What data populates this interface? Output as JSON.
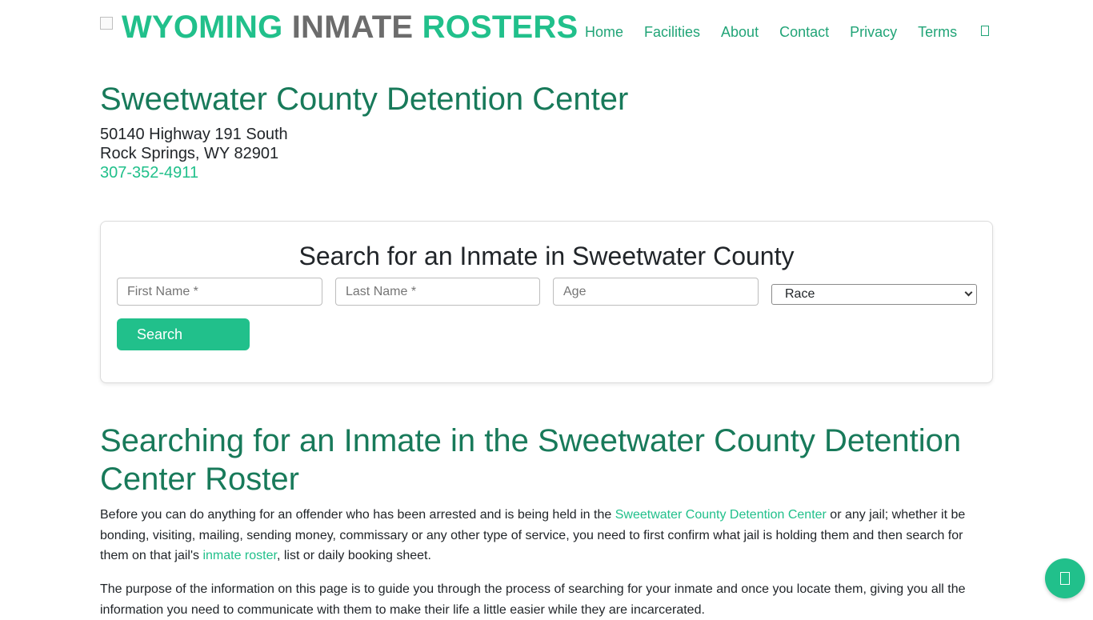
{
  "header": {
    "logo_part1": "WYOMING",
    "logo_part2": "INMATE",
    "logo_part3": "ROSTERS",
    "nav": [
      "Home",
      "Facilities",
      "About",
      "Contact",
      "Privacy",
      "Terms"
    ],
    "nav_extra_icon": "box-icon"
  },
  "facility": {
    "name": "Sweetwater County Detention Center",
    "address_line1": "50140 Highway 191 South",
    "address_line2": "Rock Springs, WY 82901",
    "phone": "307-352-4911"
  },
  "search": {
    "title": "Search for an Inmate in Sweetwater County",
    "first_name_placeholder": "First Name *",
    "last_name_placeholder": "Last Name *",
    "age_placeholder": "Age",
    "race_selected": "Race",
    "button_label": "Search"
  },
  "article": {
    "heading": "Searching for an Inmate in the Sweetwater County Detention Center Roster",
    "p1_a": "Before you can do anything for an offender who has been arrested and is being held in the ",
    "p1_link1": "Sweetwater County Detention Center",
    "p1_b": " or any jail; whether it be bonding, visiting, mailing, sending money, commissary or any other type of service, you need to first confirm what jail is holding them and then search for them on that jail's ",
    "p1_link2": "inmate roster",
    "p1_c": ", list or daily booking sheet.",
    "p2": "The purpose of the information on this page is to guide you through the process of searching for your inmate and once you locate them, giving you all the information you need to communicate with them to make their life a little easier while they are incarcerated."
  },
  "floating": {
    "icon": "chat-icon"
  },
  "colors": {
    "accent": "#21c08b",
    "heading": "#187a5a",
    "logo_gray": "#6c6c6c"
  }
}
